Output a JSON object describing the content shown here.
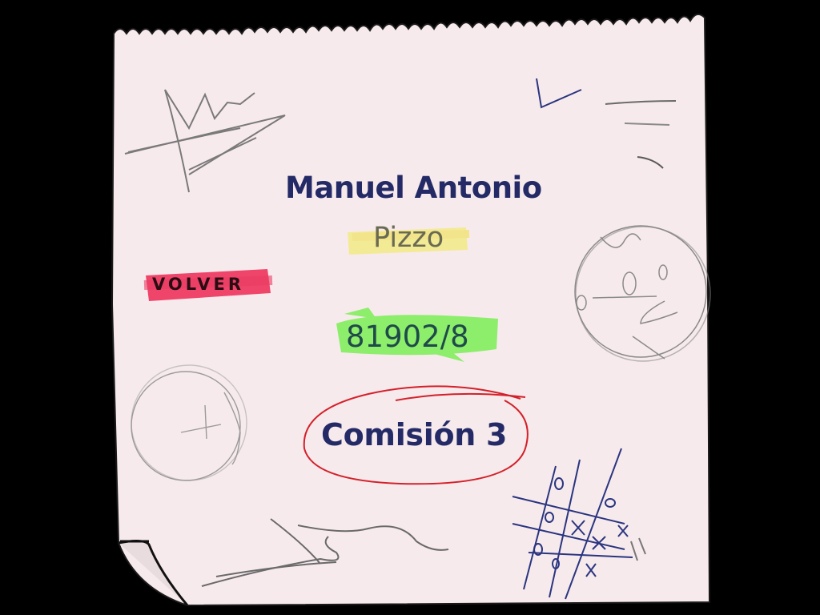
{
  "profile": {
    "first_names": "Manuel Antonio",
    "last_name": "Pizzo",
    "student_id": "81902/8",
    "commission": "Comisión 3"
  },
  "navigation": {
    "back_label": "VOLVER"
  },
  "colors": {
    "background": "#000000",
    "paper": "#f7eaec",
    "ink": "#232a66",
    "highlight_yellow": "#f2ea78",
    "highlight_green": "#72f04a",
    "highlight_red": "#f0345c",
    "circle_red": "#d4202a",
    "pencil": "#7a7a7a",
    "pen_blue": "#2a3580"
  },
  "icons": {
    "doodle_top_left": "zigzag-scribble",
    "doodle_top_right": "check-and-lines",
    "doodle_face": "sketched-face",
    "doodle_left_circle": "sketched-circle",
    "doodle_bottom": "squiggle-lines",
    "doodle_tictactoe": "tic-tac-toe-grid"
  }
}
